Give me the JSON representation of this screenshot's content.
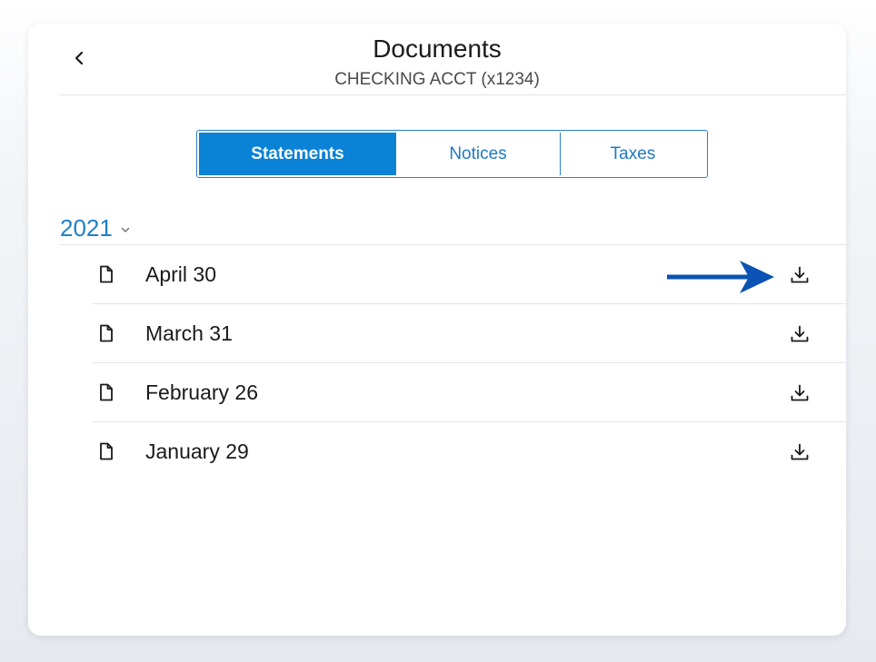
{
  "header": {
    "title": "Documents",
    "subtitle": "CHECKING ACCT (x1234)",
    "back_icon": "chevron-left-icon"
  },
  "tabs": [
    {
      "label": "Statements",
      "active": true
    },
    {
      "label": "Notices",
      "active": false
    },
    {
      "label": "Taxes",
      "active": false
    }
  ],
  "year_group": {
    "year": "2021",
    "chevron_icon": "chevron-down-icon",
    "expanded": true
  },
  "statements": [
    {
      "label": "April 30",
      "icon": "document-icon",
      "action_icon": "download-icon"
    },
    {
      "label": "March 31",
      "icon": "document-icon",
      "action_icon": "download-icon"
    },
    {
      "label": "February 26",
      "icon": "document-icon",
      "action_icon": "download-icon"
    },
    {
      "label": "January 29",
      "icon": "document-icon",
      "action_icon": "download-icon"
    }
  ],
  "colors": {
    "accent": "#0a82d6",
    "link": "#2179c4",
    "annotation_arrow": "#0a52b4"
  }
}
